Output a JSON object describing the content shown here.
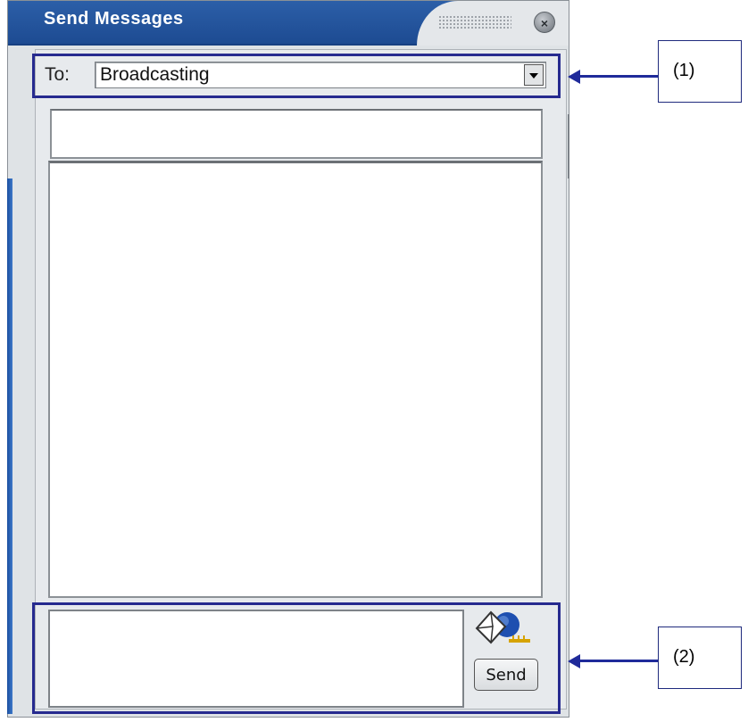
{
  "window": {
    "title": "Send Messages",
    "close_symbol": "×"
  },
  "to_row": {
    "label": "To:",
    "selected": "Broadcasting"
  },
  "compose": {
    "send_label": "Send"
  },
  "callouts": [
    {
      "label": "(1)"
    },
    {
      "label": "(2)"
    }
  ],
  "icons": {
    "close": "close-icon",
    "dropdown": "chevron-down-icon",
    "envelope": "envelope-send-icon"
  },
  "colors": {
    "title_bar": "#2c5fa8",
    "annotation": "#262a8f"
  }
}
